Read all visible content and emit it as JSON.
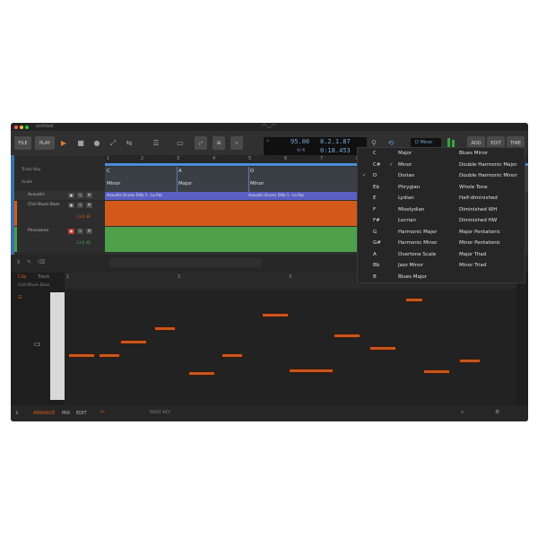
{
  "window": {
    "title": "untitled"
  },
  "toolbar": {
    "file": "FILE",
    "play": "PLAY",
    "add": "ADD",
    "edit": "EDIT",
    "time": "TIME",
    "tempo": "95.00",
    "signature": "4/4",
    "position": "8.2.1.87",
    "time_pos": "0:18.453",
    "key_display": "D Minor"
  },
  "tracks": {
    "rows": [
      "Track Key",
      "Scale"
    ],
    "items": [
      {
        "name": "Acoustic"
      },
      {
        "name": "Chill Blues Bass",
        "volume": "-13.0 dB"
      },
      {
        "name": "Pinceanne",
        "volume": "-13.0 dB"
      }
    ]
  },
  "arranger": {
    "ruler": [
      "1",
      "2",
      "3",
      "4",
      "5",
      "6",
      "7",
      "8"
    ],
    "chords": [
      "C",
      "A",
      "D"
    ],
    "scales": [
      "Minor",
      "Major",
      "Minor"
    ],
    "clip_label": "Acoustic Drums Dillo 1 - Lo Roc"
  },
  "lower": {
    "tabs": [
      "Clip",
      "Track"
    ],
    "clip_name": "Chill Blues Bass",
    "ruler": [
      "1",
      "2",
      "3"
    ],
    "c_label": "C3",
    "status": {
      "arrange": "ARRANGE",
      "mix": "MIX",
      "edit": "EDIT",
      "root_key": "ROOT KEY"
    }
  },
  "scale_menu": {
    "keys": [
      "C",
      "C#",
      "D",
      "Eb",
      "E",
      "F",
      "F#",
      "G",
      "G#",
      "A",
      "Bb",
      "B"
    ],
    "scales_col1": [
      "Major",
      "Minor",
      "Dorian",
      "Phrygian",
      "Lydian",
      "Mixolydian",
      "Locrian",
      "Harmonic Major",
      "Harmonic Minor",
      "Overtone Scale",
      "Jazz Minor",
      "Blues Major"
    ],
    "scales_col2": [
      "Blues Minor",
      "Double Harmonic Major",
      "Double Harmonic Minor",
      "Whole Tone",
      "Half-diminished",
      "Diminished WH",
      "Diminished HW",
      "Major Pentatonic",
      "Minor Pentatonic",
      "Major Triad",
      "Minor Triad"
    ],
    "checked_key": "D",
    "checked_scale": "Minor"
  }
}
